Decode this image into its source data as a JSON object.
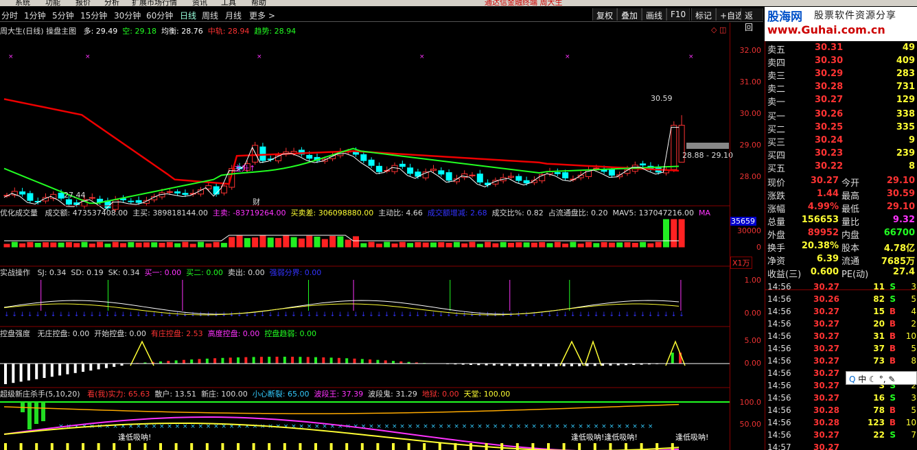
{
  "menu": {
    "items": [
      "系统",
      "功能",
      "报价",
      "分析",
      "扩展市场行情",
      "资讯",
      "工具",
      "帮助"
    ],
    "title": "通达信金融终端   周大生"
  },
  "periods": [
    "分时",
    "1分钟",
    "5分钟",
    "15分钟",
    "30分钟",
    "60分钟",
    "日线",
    "周线",
    "月线",
    "更多 >"
  ],
  "active_period": "日线",
  "toolbar": [
    "复权",
    "叠加",
    "画线",
    "F10",
    "标记",
    "+自选",
    "返回"
  ],
  "logo": {
    "brand": "股海网",
    "slogan": "股票软件资源分享",
    "url": "www.Guhai.com.cn"
  },
  "main": {
    "title": "周大生(日线)  操盘主图",
    "items": [
      {
        "t": "多: 29.49",
        "c": "#fff"
      },
      {
        "t": "空: 29.18",
        "c": "#2f2"
      },
      {
        "t": "均衡: 28.76",
        "c": "#fff"
      },
      {
        "t": "中轨: 28.94",
        "c": "#f33"
      },
      {
        "t": "趋势: 28.94",
        "c": "#2f2"
      }
    ],
    "yticks": [
      "32.00",
      "31.00",
      "30.00",
      "29.00",
      "28.00"
    ],
    "ann_high": "30.59",
    "ann_low": "27.44",
    "range_label": "28.88 - 29.10",
    "rise_label": "主升↑",
    "cai_label": "财"
  },
  "vol": {
    "title": "优化成交量",
    "items": [
      {
        "t": "成交额: 473537408.00",
        "c": "#ddd"
      },
      {
        "t": "主买: 389818144.00",
        "c": "#ddd"
      },
      {
        "t": "主卖: -83719264.00",
        "c": "#f3f"
      },
      {
        "t": "买卖差: 306098880.00",
        "c": "#ff3"
      },
      {
        "t": "主动比: 4.66",
        "c": "#ddd"
      },
      {
        "t": "成交额增减: 2.68",
        "c": "#33f"
      },
      {
        "t": "成交比%: 0.82",
        "c": "#ddd"
      },
      {
        "t": "占流通盘比: 0.20",
        "c": "#ddd"
      },
      {
        "t": "MAV5: 137047216.00",
        "c": "#ddd"
      },
      {
        "t": "MA",
        "c": "#f3f"
      }
    ],
    "badge": "35659",
    "yticks": [
      "30000",
      "0"
    ],
    "unit": "X1万"
  },
  "ind1": {
    "title": "实战操作",
    "items": [
      {
        "t": "SJ: 0.34",
        "c": "#ddd"
      },
      {
        "t": "SD: 0.19",
        "c": "#ddd"
      },
      {
        "t": "SK: 0.34",
        "c": "#ddd"
      },
      {
        "t": "买一: 0.00",
        "c": "#f3f"
      },
      {
        "t": "买二: 0.00",
        "c": "#2f2"
      },
      {
        "t": "卖出: 0.00",
        "c": "#ddd"
      },
      {
        "t": "强弱分界: 0.00",
        "c": "#33f"
      }
    ],
    "yticks": [
      "1.00",
      "0.00"
    ]
  },
  "ind2": {
    "title": "控盘强度",
    "items": [
      {
        "t": "无庄控盘: 0.00",
        "c": "#ddd"
      },
      {
        "t": "开始控盘: 0.00",
        "c": "#ddd"
      },
      {
        "t": "有庄控盘: 2.53",
        "c": "#f33"
      },
      {
        "t": "高度控盘: 0.00",
        "c": "#f3f"
      },
      {
        "t": "控盘趋弱: 0.00",
        "c": "#2f2"
      }
    ],
    "yticks": [
      "5.00",
      "0.00"
    ]
  },
  "ind3": {
    "title": "超级新庄杀手(5,10,20)",
    "items": [
      {
        "t": "看(我)实力: 65.63",
        "c": "#f33"
      },
      {
        "t": "散户: 13.51",
        "c": "#ddd"
      },
      {
        "t": "新庄: 100.00",
        "c": "#ddd"
      },
      {
        "t": "小心断裂: 65.00",
        "c": "#3cf"
      },
      {
        "t": "波段王: 37.39",
        "c": "#f3f"
      },
      {
        "t": "波段鬼: 31.29",
        "c": "#ddd"
      },
      {
        "t": "地狱: 0.00",
        "c": "#f33"
      },
      {
        "t": "天堂: 100.00",
        "c": "#ff3"
      }
    ],
    "yticks": [
      "100.0",
      "50.00"
    ],
    "labels": [
      "逢低吸呐!",
      "逢低吸呐!逢低吸呐!",
      "逢低吸呐!"
    ]
  },
  "quote": {
    "asks": [
      {
        "l": "卖五",
        "p": "30.31",
        "v": "49"
      },
      {
        "l": "卖四",
        "p": "30.30",
        "v": "409"
      },
      {
        "l": "卖三",
        "p": "30.29",
        "v": "283"
      },
      {
        "l": "卖二",
        "p": "30.28",
        "v": "731"
      },
      {
        "l": "卖一",
        "p": "30.27",
        "v": "129"
      }
    ],
    "bids": [
      {
        "l": "买一",
        "p": "30.26",
        "v": "338"
      },
      {
        "l": "买二",
        "p": "30.25",
        "v": "335"
      },
      {
        "l": "买三",
        "p": "30.24",
        "v": "9"
      },
      {
        "l": "买四",
        "p": "30.23",
        "v": "239"
      },
      {
        "l": "买五",
        "p": "30.22",
        "v": "8"
      }
    ],
    "stats": [
      {
        "l1": "现价",
        "v1": "30.27",
        "c1": "#f33",
        "l2": "今开",
        "v2": "29.10",
        "c2": "#f33"
      },
      {
        "l1": "涨跌",
        "v1": "1.44",
        "c1": "#f33",
        "l2": "最高",
        "v2": "30.59",
        "c2": "#f33"
      },
      {
        "l1": "涨幅",
        "v1": "4.99%",
        "c1": "#f33",
        "l2": "最低",
        "v2": "29.10",
        "c2": "#f33"
      },
      {
        "l1": "总量",
        "v1": "156653",
        "c1": "#ff3",
        "l2": "量比",
        "v2": "9.32",
        "c2": "#f3f"
      },
      {
        "l1": "外盘",
        "v1": "89952",
        "c1": "#f33",
        "l2": "内盘",
        "v2": "66700",
        "c2": "#2f2"
      },
      {
        "l1": "换手",
        "v1": "20.38%",
        "c1": "#ff3",
        "l2": "股本",
        "v2": "4.78亿",
        "c2": "#ff3"
      },
      {
        "l1": "净资",
        "v1": "6.39",
        "c1": "#ff3",
        "l2": "流通",
        "v2": "7685万",
        "c2": "#ff3"
      },
      {
        "l1": "收益(三)",
        "v1": "0.600",
        "c1": "#ff3",
        "l2": "PE(动)",
        "v2": "27.4",
        "c2": "#ff3"
      }
    ],
    "ticks": [
      {
        "t": "14:56",
        "p": "30.27",
        "v": "11",
        "s": "S",
        "n": "3"
      },
      {
        "t": "14:56",
        "p": "30.26",
        "v": "82",
        "s": "S",
        "n": "5"
      },
      {
        "t": "14:56",
        "p": "30.27",
        "v": "15",
        "s": "B",
        "n": "4"
      },
      {
        "t": "14:56",
        "p": "30.27",
        "v": "20",
        "s": "B",
        "n": "2"
      },
      {
        "t": "14:56",
        "p": "30.27",
        "v": "31",
        "s": "B",
        "n": "10"
      },
      {
        "t": "14:56",
        "p": "30.27",
        "v": "37",
        "s": "B",
        "n": "5"
      },
      {
        "t": "14:56",
        "p": "30.27",
        "v": "73",
        "s": "B",
        "n": "8"
      },
      {
        "t": "14:56",
        "p": "30.27",
        "v": "",
        "s": "",
        "n": ""
      },
      {
        "t": "14:56",
        "p": "30.27",
        "v": "3",
        "s": "S",
        "n": "2"
      },
      {
        "t": "14:56",
        "p": "30.27",
        "v": "16",
        "s": "S",
        "n": "3"
      },
      {
        "t": "14:56",
        "p": "30.28",
        "v": "78",
        "s": "B",
        "n": "5"
      },
      {
        "t": "14:56",
        "p": "30.28",
        "v": "123",
        "s": "B",
        "n": "10"
      },
      {
        "t": "14:56",
        "p": "30.27",
        "v": "22",
        "s": "S",
        "n": "7"
      },
      {
        "t": "14:57",
        "p": "30.27",
        "v": "",
        "s": "",
        "n": ""
      }
    ]
  },
  "ime": "中"
}
